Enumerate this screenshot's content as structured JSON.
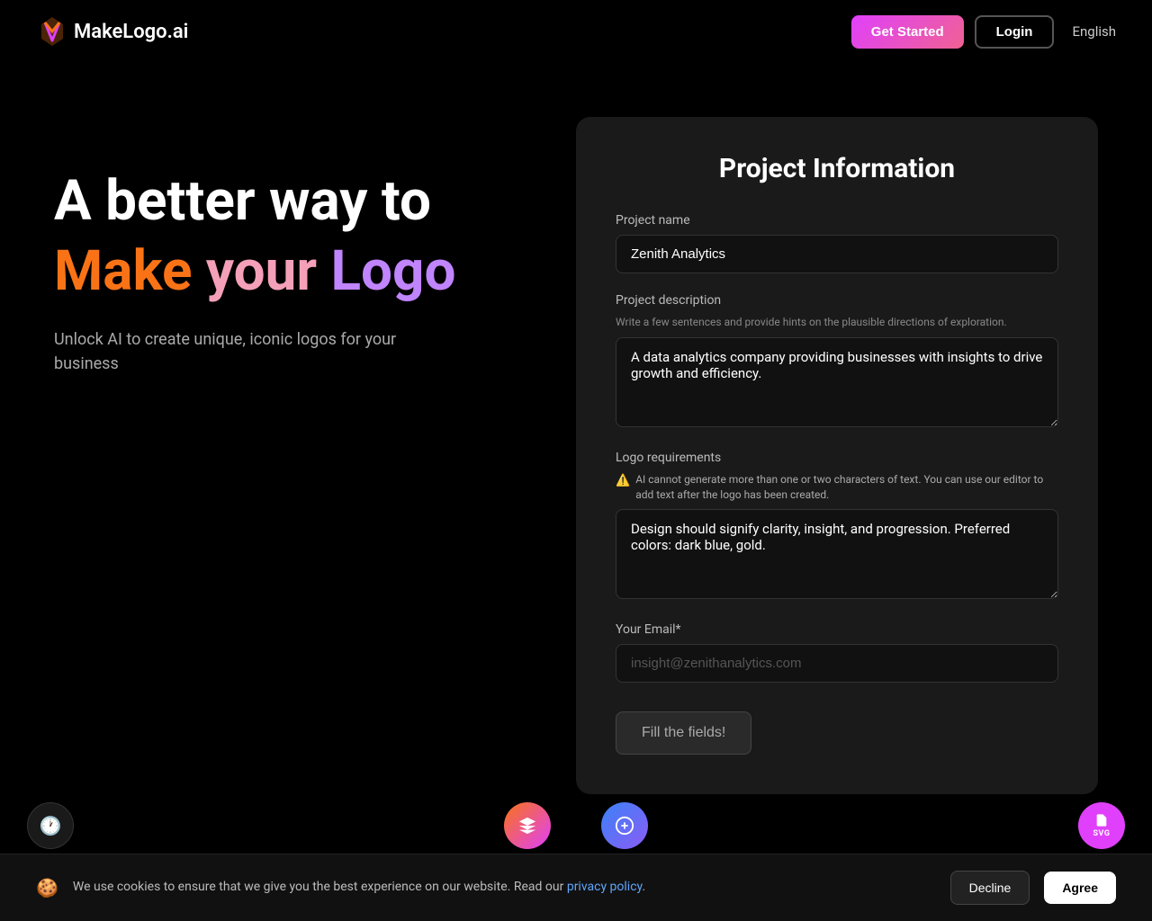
{
  "header": {
    "logo_text": "akeLogo.ai",
    "logo_m": "M",
    "get_started_label": "Get Started",
    "login_label": "Login",
    "language_label": "English"
  },
  "hero": {
    "title_line1": "A better way to",
    "title_word1": "Make",
    "title_word2": "your",
    "title_word3": "Logo",
    "subtitle": "Unlock AI to create unique, iconic logos for your business"
  },
  "form": {
    "title": "Project Information",
    "project_name_label": "Project name",
    "project_name_value": "Zenith Analytics",
    "project_description_label": "Project description",
    "project_description_sublabel": "Write a few sentences and provide hints on the plausible directions of exploration.",
    "project_description_value": "A data analytics company providing businesses with insights to drive growth and efficiency.",
    "logo_requirements_label": "Logo requirements",
    "logo_requirements_warning": "AI cannot generate more than one or two characters of text. You can use our editor to add text after the logo has been created.",
    "logo_requirements_value": "Design should signify clarity, insight, and progression. Preferred colors: dark blue, gold.",
    "email_label": "Your Email*",
    "email_placeholder": "insight@zenithanalytics.com",
    "submit_label": "Fill the fields!"
  },
  "cookie": {
    "text": "We use cookies to ensure that we give you the best experience on our website. Read our",
    "link_text": "privacy policy",
    "decline_label": "Decline",
    "agree_label": "Agree"
  },
  "fabs": {
    "clock_label": "⏰",
    "svg_label": "SVG"
  }
}
